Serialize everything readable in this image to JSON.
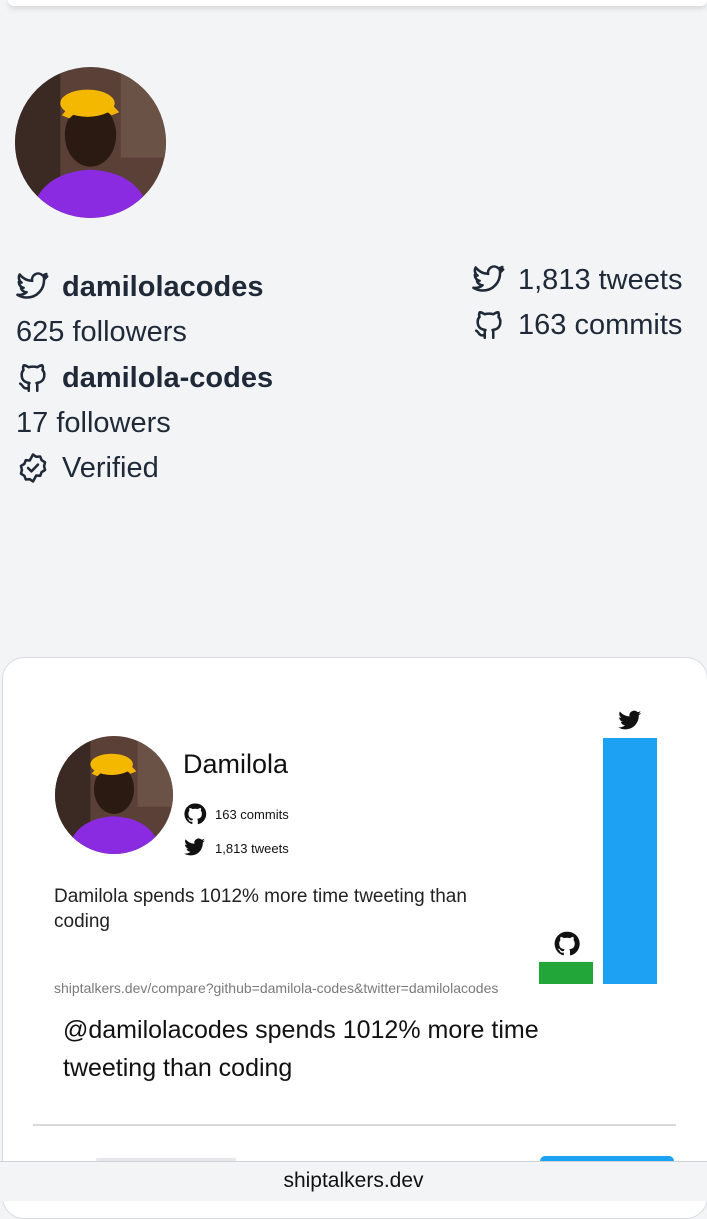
{
  "profile": {
    "twitter_handle": "damilolacodes",
    "twitter_followers": "625 followers",
    "github_handle": "damilola-codes",
    "github_followers": "17 followers",
    "verified_label": "Verified",
    "tweets": "1,813 tweets",
    "commits": "163 commits"
  },
  "card": {
    "name": "Damilola",
    "commits": "163 commits",
    "tweets": "1,813 tweets",
    "summary": "Damilola spends 1012% more time tweeting than coding",
    "url": "shiptalkers.dev/compare?github=damilola-codes&twitter=damilolacodes",
    "tweet_text": "@damilolacodes spends 1012% more time tweeting than coding"
  },
  "chart_data": {
    "type": "bar",
    "categories": [
      "github",
      "twitter"
    ],
    "values": [
      163,
      1813
    ],
    "colors": [
      "#22a63a",
      "#1da1f2"
    ]
  },
  "footer": {
    "domain": "shiptalkers.dev"
  }
}
